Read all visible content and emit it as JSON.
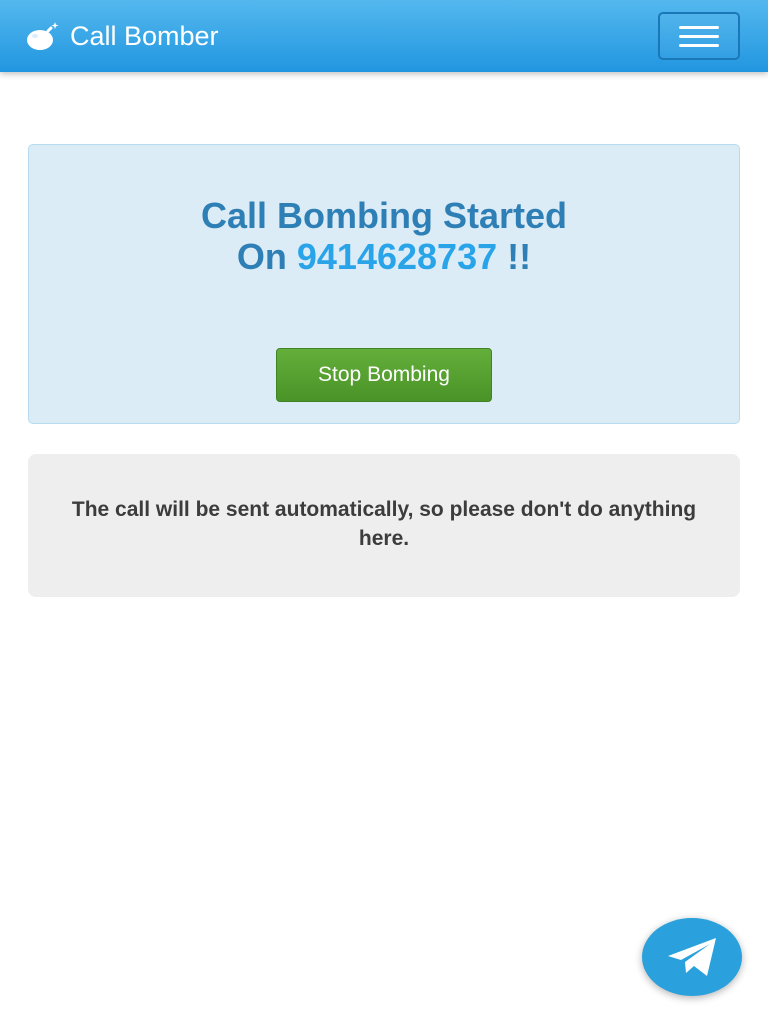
{
  "header": {
    "brand_icon": "bomb-icon",
    "brand_title": "Call Bomber",
    "menu_icon": "hamburger-menu-icon"
  },
  "status": {
    "line1": "Call Bombing Started",
    "prefix": "On",
    "phone_number": "9414628737",
    "suffix": "!!",
    "stop_label": "Stop Bombing"
  },
  "notice": {
    "text": "The call will be sent automatically, so please don't do anything here."
  },
  "floating": {
    "icon": "telegram-icon"
  },
  "colors": {
    "navbar": "#2196e0",
    "heading": "#2e7fb5",
    "phone": "#29a4e8",
    "stop_button": "#4a9428",
    "alert_background": "#dbecf6",
    "notice_background": "#eeeeee",
    "telegram": "#2aa1dc"
  }
}
